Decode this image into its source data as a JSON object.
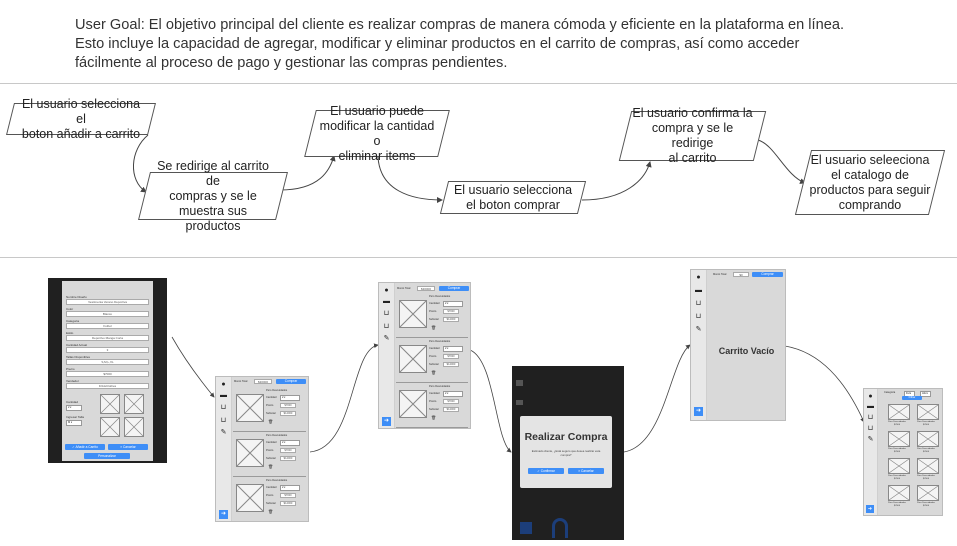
{
  "goal": {
    "line1": "User Goal:  El objetivo principal del cliente es realizar compras de manera cómoda y eficiente en la plataforma en línea.",
    "line2": "Esto incluye la capacidad de agregar, modificar y eliminar productos en el carrito de compras, así como acceder",
    "line3": "fácilmente al proceso de pago y gestionar las compras pendientes."
  },
  "flow": [
    {
      "line1": "El usuario selecciona el",
      "line2": "boton añadir a carrito"
    },
    {
      "line1": "Se redirige al carrito de",
      "line2": "compras y se le",
      "line3": "muestra sus productos"
    },
    {
      "line1": "El usuario puede",
      "line2": "modificar la cantidad o",
      "line3": "eliminar items"
    },
    {
      "line1": "El usuario selecciona",
      "line2": "el boton comprar"
    },
    {
      "line1": "El usuario confirma la",
      "line2": "compra y se le redirige",
      "line3": "al carrito"
    },
    {
      "line1": "El usuario seleeciona",
      "line2": "el catalogo de",
      "line3": "productos para seguir",
      "line4": "comprando"
    }
  ],
  "mock1": {
    "fields": [
      {
        "label": "Nombre Diseño",
        "value": "Vestimenta Verano Deportiva"
      },
      {
        "label": "Color",
        "value": "Blanco"
      },
      {
        "label": "Categoria",
        "value": "Futbol"
      },
      {
        "label": "Estilo",
        "value": "Deportivo Manga Corta"
      },
      {
        "label": "Cantidad Actual",
        "value": "3"
      },
      {
        "label": "Tallas Disponibles",
        "value": "S,M,L,XL"
      },
      {
        "label": "Precio",
        "value": "$7000"
      },
      {
        "label": "Vendedor",
        "value": "FrikisClothes"
      }
    ],
    "qty_label": "Cantidad",
    "qty_value": "2",
    "size_label": "Ingresar Talla",
    "size_value": "M",
    "add_label": "✓ Añadir a Carrito",
    "cancel_label": "× Cancelar",
    "bottom_label": "Personalizar"
  },
  "cart": {
    "header_label": "Monto Total",
    "header_value": "$30000",
    "buy_label": "Comprar",
    "item_name": "Pero Descuidados",
    "qty_label": "Cantidad",
    "qty_value": "2",
    "price_label": "Precio",
    "price_value": "$7000",
    "subtotal_label": "Subtotal",
    "subtotal_value": "$14000",
    "delete_icon": "trash-icon"
  },
  "confirm": {
    "title": "Realizar Compra",
    "message": "Estimado cliente, ¿Está seguro que desea realizar esta compra?",
    "confirm_label": "✓ Confirmar",
    "cancel_label": "× Cancelar"
  },
  "empty": {
    "header_label": "Monto Total",
    "header_value": "$0",
    "buy_label": "Comprar",
    "message": "Carrito Vacío"
  },
  "catalog": {
    "filter_label": "Categoria",
    "filter_value": "Fut",
    "sort_value": "Abc",
    "filter_btn": "Filtrar",
    "item_name": "Pero Descuidados",
    "item_price": "$7000"
  },
  "sidebar_icons": [
    "user-icon",
    "shirt-icon",
    "cart-icon",
    "cart-icon",
    "cart-icon",
    "palette-icon"
  ],
  "colors": {
    "accent": "#3e8ef7",
    "wire_bg": "#d9d9d9",
    "dark_bg": "#202020"
  }
}
